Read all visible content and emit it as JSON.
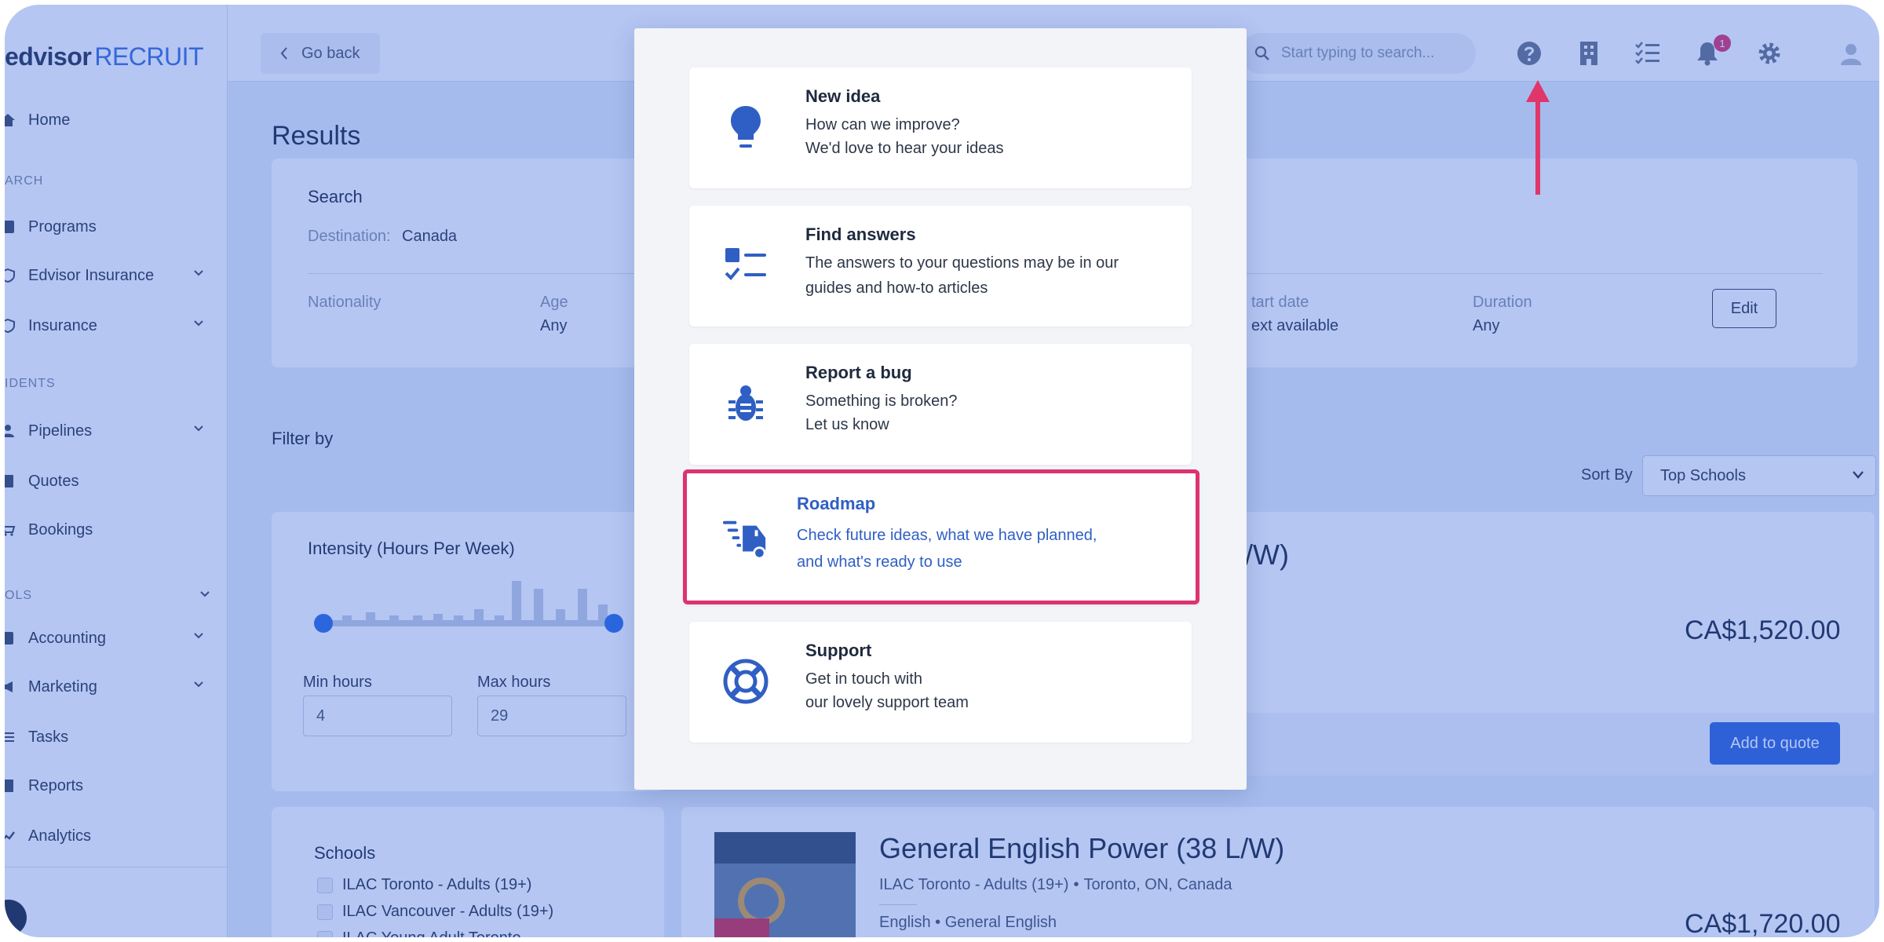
{
  "logo": {
    "brand": "edvisor",
    "product": "RECRUIT"
  },
  "topbar": {
    "go_back": "Go back",
    "search_placeholder": "Start typing to search...",
    "notification_count": "1"
  },
  "sidebar": {
    "home": "Home",
    "section_search": "ARCH",
    "programs": "Programs",
    "edvisor_insurance": "Edvisor Insurance",
    "insurance": "Insurance",
    "section_students": "IDENTS",
    "pipelines": "Pipelines",
    "quotes": "Quotes",
    "bookings": "Bookings",
    "section_tools": "OLS",
    "accounting": "Accounting",
    "marketing": "Marketing",
    "tasks": "Tasks",
    "reports": "Reports",
    "analytics": "Analytics"
  },
  "main": {
    "title": "Results",
    "search": {
      "heading": "Search",
      "destination_label": "Destination:",
      "destination_value": "Canada",
      "nationality_label": "Nationality",
      "age_label": "Age",
      "age_value": "Any",
      "start_date_label": "tart date",
      "start_date_value": "ext available",
      "duration_label": "Duration",
      "duration_value": "Any",
      "edit_label": "Edit"
    },
    "filter_by": "Filter by",
    "sort_by_label": "Sort By",
    "sort_by_value": "Top Schools",
    "intensity": {
      "heading": "Intensity (Hours Per Week)",
      "min_label": "Min hours",
      "min_value": "4",
      "max_label": "Max hours",
      "max_value": "29"
    },
    "schools": {
      "heading": "Schools",
      "items": [
        "ILAC Toronto - Adults (19+)",
        "ILAC Vancouver - Adults (19+)",
        "ILAC Young Adult Toronto"
      ]
    },
    "result1": {
      "title_fragment": "/W)",
      "price": "CA$1,520.00",
      "add_to_quote": "Add to quote"
    },
    "result2": {
      "title": "General English Power (38 L/W)",
      "school": "ILAC Toronto - Adults (19+)",
      "location": "Toronto, ON, Canada",
      "tags": "English • General English",
      "price": "CA$1,720.00"
    }
  },
  "modal": {
    "items": [
      {
        "title": "New idea",
        "line1": "How can we improve?",
        "line2": "We'd love to hear your ideas"
      },
      {
        "title": "Find answers",
        "line1": "The answers to your questions may be in our",
        "line2": "guides and how-to articles"
      },
      {
        "title": "Report a bug",
        "line1": "Something is broken?",
        "line2": "Let us know"
      },
      {
        "title": "Roadmap",
        "line1": "Check future ideas, what we have planned,",
        "line2": "and what's ready to use"
      },
      {
        "title": "Support",
        "line1": "Get in touch with",
        "line2": "our lovely support team"
      }
    ]
  },
  "colors": {
    "overlay": "#2658dc",
    "accent": "#3367d6",
    "highlight": "#dd3270"
  }
}
